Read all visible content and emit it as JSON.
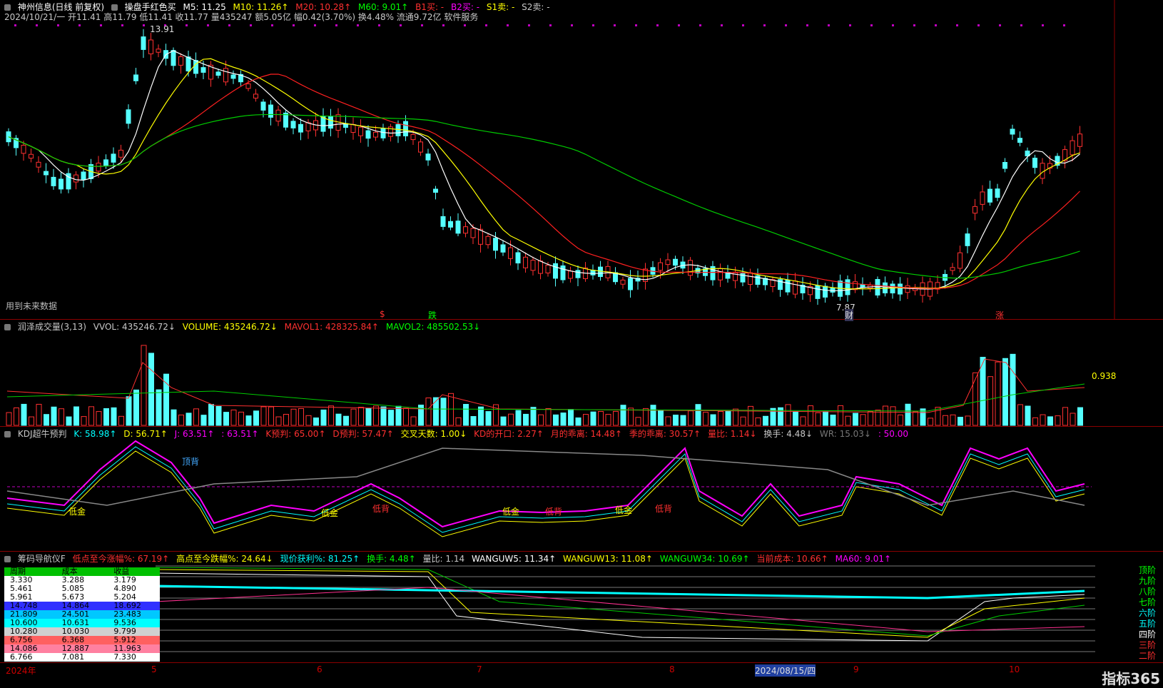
{
  "main": {
    "title": "神州信息(日线 前复权)",
    "formula": "操盘手红色买",
    "ma": [
      {
        "label": "M5: 11.25",
        "color": "#ffffff"
      },
      {
        "label": "M10: 11.26↑",
        "color": "#ffff00"
      },
      {
        "label": "M20: 10.28↑",
        "color": "#ff3030"
      },
      {
        "label": "M60: 9.01↑",
        "color": "#00ff00"
      },
      {
        "label": "B1买: -",
        "color": "#ff3030"
      },
      {
        "label": "B2买: -",
        "color": "#ff00ff"
      },
      {
        "label": "S1卖: -",
        "color": "#ffff00"
      },
      {
        "label": "S2卖: -",
        "color": "#c8c8c8"
      }
    ],
    "info": "2024/10/21/一 开11.41 高11.79 低11.41 收11.77 量435247 额5.05亿 幅0.42(3.70%) 换4.48% 流通9.72亿 软件服务",
    "high_label": "13.91",
    "low_label": "7.87",
    "future_label": "用到未来数据",
    "tags": [
      "$",
      "跌",
      "财",
      "涨"
    ]
  },
  "volume": {
    "header": [
      {
        "label": "润泽成交量(3,13)",
        "color": "#c8c8c8"
      },
      {
        "label": "VVOL: 435246.72↓",
        "color": "#c8c8c8"
      },
      {
        "label": "VOLUME: 435246.72↓",
        "color": "#ffff00"
      },
      {
        "label": "MAVOL1: 428325.84↑",
        "color": "#ff3030"
      },
      {
        "label": "MAVOL2: 485502.53↓",
        "color": "#00ff00"
      }
    ],
    "right_label": "0.938"
  },
  "kdj": {
    "header": [
      {
        "label": "KDJ超牛预判",
        "color": "#c8c8c8"
      },
      {
        "label": "K: 58.98↑",
        "color": "#00ffff"
      },
      {
        "label": "D: 56.71↑",
        "color": "#ffff00"
      },
      {
        "label": "J: 63.51↑",
        "color": "#ff00ff"
      },
      {
        "label": ": 63.51↑",
        "color": "#ff00ff"
      },
      {
        "label": "K预判: 65.00↑",
        "color": "#ff3030"
      },
      {
        "label": "D预判: 57.47↑",
        "color": "#ff3030"
      },
      {
        "label": "交叉天数: 1.00↓",
        "color": "#ffff00"
      },
      {
        "label": "KD的开口: 2.27↑",
        "color": "#ff3030"
      },
      {
        "label": "月的乖离: 14.48↑",
        "color": "#ff3030"
      },
      {
        "label": "季的乖离: 30.57↑",
        "color": "#ff3030"
      },
      {
        "label": "量比: 1.14↓",
        "color": "#ff3030"
      },
      {
        "label": "换手: 4.48↓",
        "color": "#c8c8c8"
      },
      {
        "label": "WR: 15.03↓",
        "color": "#777777"
      },
      {
        "label": ": 50.00",
        "color": "#ff00ff"
      }
    ],
    "marks": [
      "顶背",
      "低金",
      "低金",
      "低背",
      "低金",
      "低背",
      "低金",
      "低背"
    ]
  },
  "chip": {
    "header": [
      {
        "label": "筹码导航仪F",
        "color": "#c8c8c8"
      },
      {
        "label": "低点至今涨幅%: 67.19↑",
        "color": "#ff3030"
      },
      {
        "label": "高点至今跌幅%: 24.64↓",
        "color": "#ffff00"
      },
      {
        "label": "现价获利%: 81.25↑",
        "color": "#00ffff"
      },
      {
        "label": "换手: 4.48↑",
        "color": "#00ff00"
      },
      {
        "label": "量比: 1.14",
        "color": "#c8c8c8"
      },
      {
        "label": "WANGUW5: 11.34↑",
        "color": "#ffffff"
      },
      {
        "label": "WANGUW13: 11.08↑",
        "color": "#ffff00"
      },
      {
        "label": "WANGUW34: 10.69↑",
        "color": "#00ff00"
      },
      {
        "label": "当前成本: 10.66↑",
        "color": "#ff3030"
      },
      {
        "label": "MA60: 9.01↑",
        "color": "#ff00ff"
      }
    ],
    "table": [
      {
        "c": [
          "周期",
          "成本",
          "收益"
        ],
        "bg": "#00c000"
      },
      {
        "c": [
          "3.330",
          "3.288",
          "3.179"
        ],
        "bg": "#ffffff"
      },
      {
        "c": [
          "5.461",
          "5.085",
          "4.890"
        ],
        "bg": "#ffffff"
      },
      {
        "c": [
          "5.961",
          "5.673",
          "5.204"
        ],
        "bg": "#ffffff"
      },
      {
        "c": [
          "14.748",
          "14.864",
          "18.692"
        ],
        "bg": "#3030ff"
      },
      {
        "c": [
          "21.809",
          "24.501",
          "23.483"
        ],
        "bg": "#00c8ff"
      },
      {
        "c": [
          "10.600",
          "10.631",
          "9.536"
        ],
        "bg": "#00ffff"
      },
      {
        "c": [
          "10.280",
          "10.030",
          "9.799"
        ],
        "bg": "#d0d0d0"
      },
      {
        "c": [
          "6.756",
          "6.368",
          "5.912"
        ],
        "bg": "#ff6060"
      },
      {
        "c": [
          "14.086",
          "12.887",
          "11.963"
        ],
        "bg": "#ff80a0"
      },
      {
        "c": [
          "6.766",
          "7.081",
          "7.330"
        ],
        "bg": "#ffffff"
      }
    ],
    "levels": [
      {
        "label": "顶阶",
        "color": "#00ff00"
      },
      {
        "label": "九阶",
        "color": "#00ff00"
      },
      {
        "label": "八阶",
        "color": "#00ff00"
      },
      {
        "label": "七阶",
        "color": "#00ff00"
      },
      {
        "label": "六阶",
        "color": "#00ffff"
      },
      {
        "label": "五阶",
        "color": "#00ffff"
      },
      {
        "label": "四阶",
        "color": "#ffffff"
      },
      {
        "label": "三阶",
        "color": "#ff3030"
      },
      {
        "label": "二阶",
        "color": "#ff3030"
      }
    ]
  },
  "xaxis": {
    "labels": [
      "2024年",
      "5",
      "6",
      "7",
      "8",
      "2024/08/15/四",
      "9",
      "10"
    ],
    "logo": "指标365"
  }
}
